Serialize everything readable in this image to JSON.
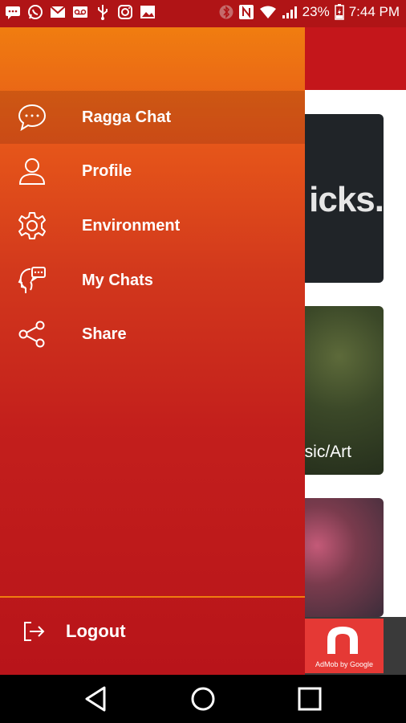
{
  "status_bar": {
    "battery": "23%",
    "time": "7:44 PM",
    "left_icons": [
      "messages-icon",
      "whatsapp-icon",
      "gmail-icon",
      "voicemail-icon",
      "usb-icon",
      "instagram-icon",
      "gallery-icon"
    ],
    "right_icons": [
      "bluetooth-icon",
      "nfc-icon",
      "wifi-icon",
      "signal-icon",
      "battery-icon"
    ]
  },
  "drawer": {
    "items": [
      {
        "label": "Ragga Chat",
        "icon": "chat-bubble-icon",
        "active": true
      },
      {
        "label": "Profile",
        "icon": "person-icon"
      },
      {
        "label": "Environment",
        "icon": "gear-icon"
      },
      {
        "label": "My Chats",
        "icon": "head-chat-icon"
      },
      {
        "label": "Share",
        "icon": "share-icon"
      }
    ],
    "logout_label": "Logout"
  },
  "content": {
    "card1_text": "icks.",
    "card2_text": "sic/Art"
  },
  "ad": {
    "caption": "AdMob by Google"
  },
  "navbar": {
    "buttons": [
      "back-icon",
      "home-icon",
      "recents-icon"
    ]
  },
  "colors": {
    "drawer_top": "#f07d10",
    "drawer_bottom": "#b8141a",
    "appbar": "#c4161b",
    "statusbar": "#b01416"
  }
}
